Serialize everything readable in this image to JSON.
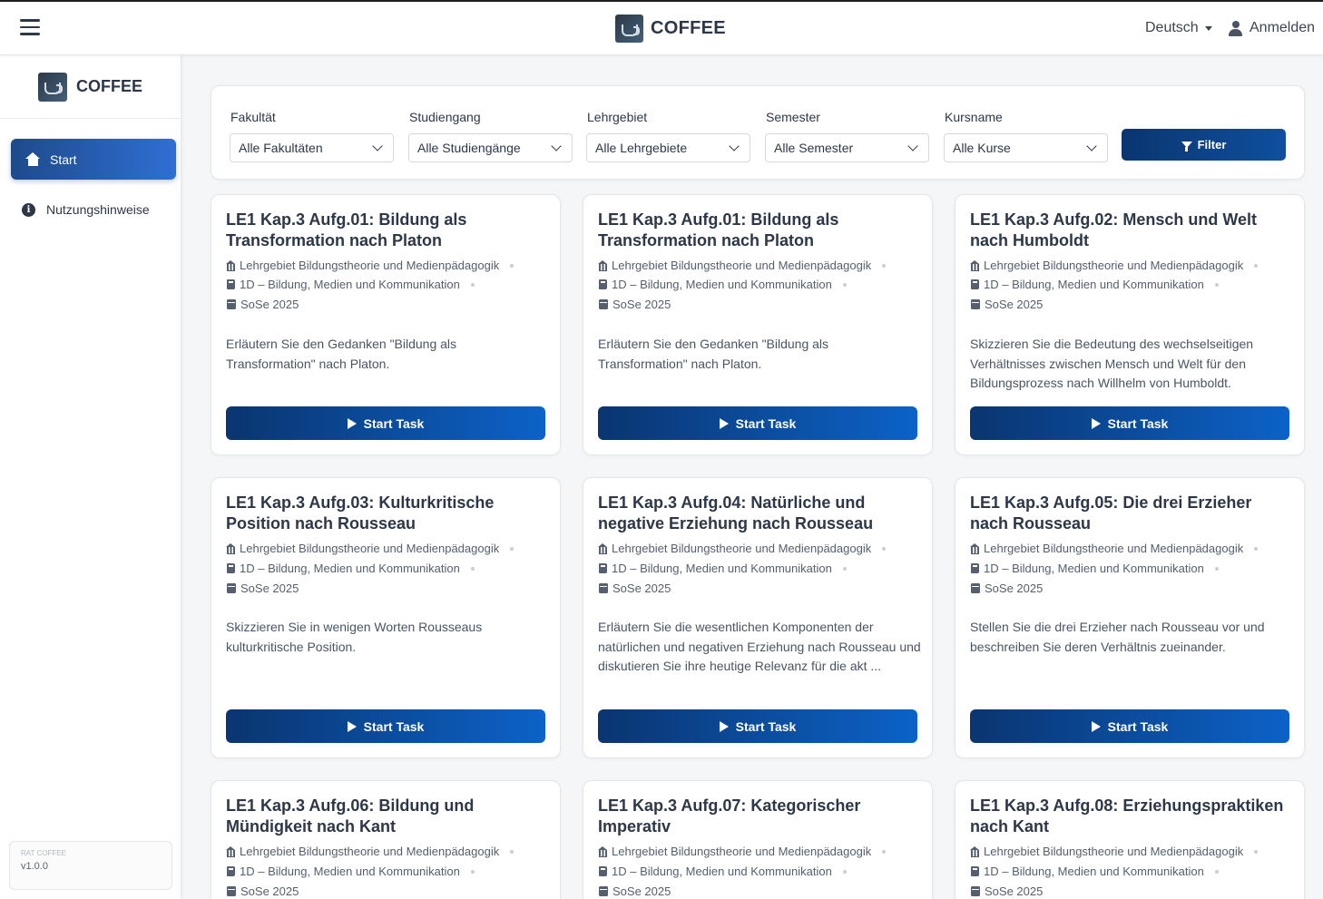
{
  "app": {
    "title": "COFFEE",
    "version": "v1.0.0",
    "version_logo_text": "RAT COFFEE"
  },
  "topbar": {
    "language": "Deutsch",
    "login": "Anmelden"
  },
  "sidebar": {
    "title": "COFFEE",
    "items": [
      {
        "label": "Start"
      },
      {
        "label": "Nutzungshinweise"
      }
    ]
  },
  "filters": {
    "faculty": {
      "label": "Fakultät",
      "value": "Alle Fakultäten"
    },
    "program": {
      "label": "Studiengang",
      "value": "Alle Studiengänge"
    },
    "area": {
      "label": "Lehrgebiet",
      "value": "Alle Lehrgebiete"
    },
    "semester": {
      "label": "Semester",
      "value": "Alle Semester"
    },
    "course": {
      "label": "Kursname",
      "value": "Alle Kurse"
    },
    "button": "Filter"
  },
  "cards": [
    {
      "title": "LE1 Kap.3 Aufg.01: Bildung als Transformation nach Platon",
      "area": "Lehrgebiet Bildungstheorie und Medienpädagogik",
      "module": "1D – Bildung, Medien und Kommunikation",
      "semester": "SoSe 2025",
      "description": "Erläutern Sie den Gedanken \"Bildung als Transformation\" nach Platon.",
      "button": "Start Task"
    },
    {
      "title": "LE1 Kap.3 Aufg.01: Bildung als Transformation nach Platon",
      "area": "Lehrgebiet Bildungstheorie und Medienpädagogik",
      "module": "1D – Bildung, Medien und Kommunikation",
      "semester": "SoSe 2025",
      "description": "Erläutern Sie den Gedanken \"Bildung als Transformation\" nach Platon.",
      "button": "Start Task"
    },
    {
      "title": "LE1 Kap.3 Aufg.02: Mensch und Welt nach Humboldt",
      "area": "Lehrgebiet Bildungstheorie und Medienpädagogik",
      "module": "1D – Bildung, Medien und Kommunikation",
      "semester": "SoSe 2025",
      "description": "Skizzieren Sie die Bedeutung des wechselseitigen Verhältnisses zwischen Mensch und Welt für den Bildungsprozess nach Willhelm von Humboldt.",
      "button": "Start Task"
    },
    {
      "title": "LE1 Kap.3 Aufg.03: Kulturkritische Position nach Rousseau",
      "area": "Lehrgebiet Bildungstheorie und Medienpädagogik",
      "module": "1D – Bildung, Medien und Kommunikation",
      "semester": "SoSe 2025",
      "description": "Skizzieren Sie in wenigen Worten Rousseaus kulturkritische Position.",
      "button": "Start Task"
    },
    {
      "title": "LE1 Kap.3 Aufg.04: Natürliche und negative Erziehung nach Rousseau",
      "area": "Lehrgebiet Bildungstheorie und Medienpädagogik",
      "module": "1D – Bildung, Medien und Kommunikation",
      "semester": "SoSe 2025",
      "description": "Erläutern Sie die wesentlichen Komponenten der natürlichen und negativen Erziehung nach Rousseau und diskutieren Sie ihre heutige Relevanz für die akt ...",
      "button": "Start Task"
    },
    {
      "title": "LE1 Kap.3 Aufg.05: Die drei Erzieher nach Rousseau",
      "area": "Lehrgebiet Bildungstheorie und Medienpädagogik",
      "module": "1D – Bildung, Medien und Kommunikation",
      "semester": "SoSe 2025",
      "description": "Stellen Sie die drei Erzieher nach Rousseau vor und beschreiben Sie deren Verhältnis zueinander.",
      "button": "Start Task"
    },
    {
      "title": "LE1 Kap.3 Aufg.06: Bildung und Mündigkeit nach Kant",
      "area": "Lehrgebiet Bildungstheorie und Medienpädagogik",
      "module": "1D – Bildung, Medien und Kommunikation",
      "semester": "SoSe 2025"
    },
    {
      "title": "LE1 Kap.3 Aufg.07: Kategorischer Imperativ",
      "area": "Lehrgebiet Bildungstheorie und Medienpädagogik",
      "module": "1D – Bildung, Medien und Kommunikation",
      "semester": "SoSe 2025"
    },
    {
      "title": "LE1 Kap.3 Aufg.08: Erziehungspraktiken nach Kant",
      "area": "Lehrgebiet Bildungstheorie und Medienpädagogik",
      "module": "1D – Bildung, Medien und Kommunikation",
      "semester": "SoSe 2025"
    }
  ]
}
